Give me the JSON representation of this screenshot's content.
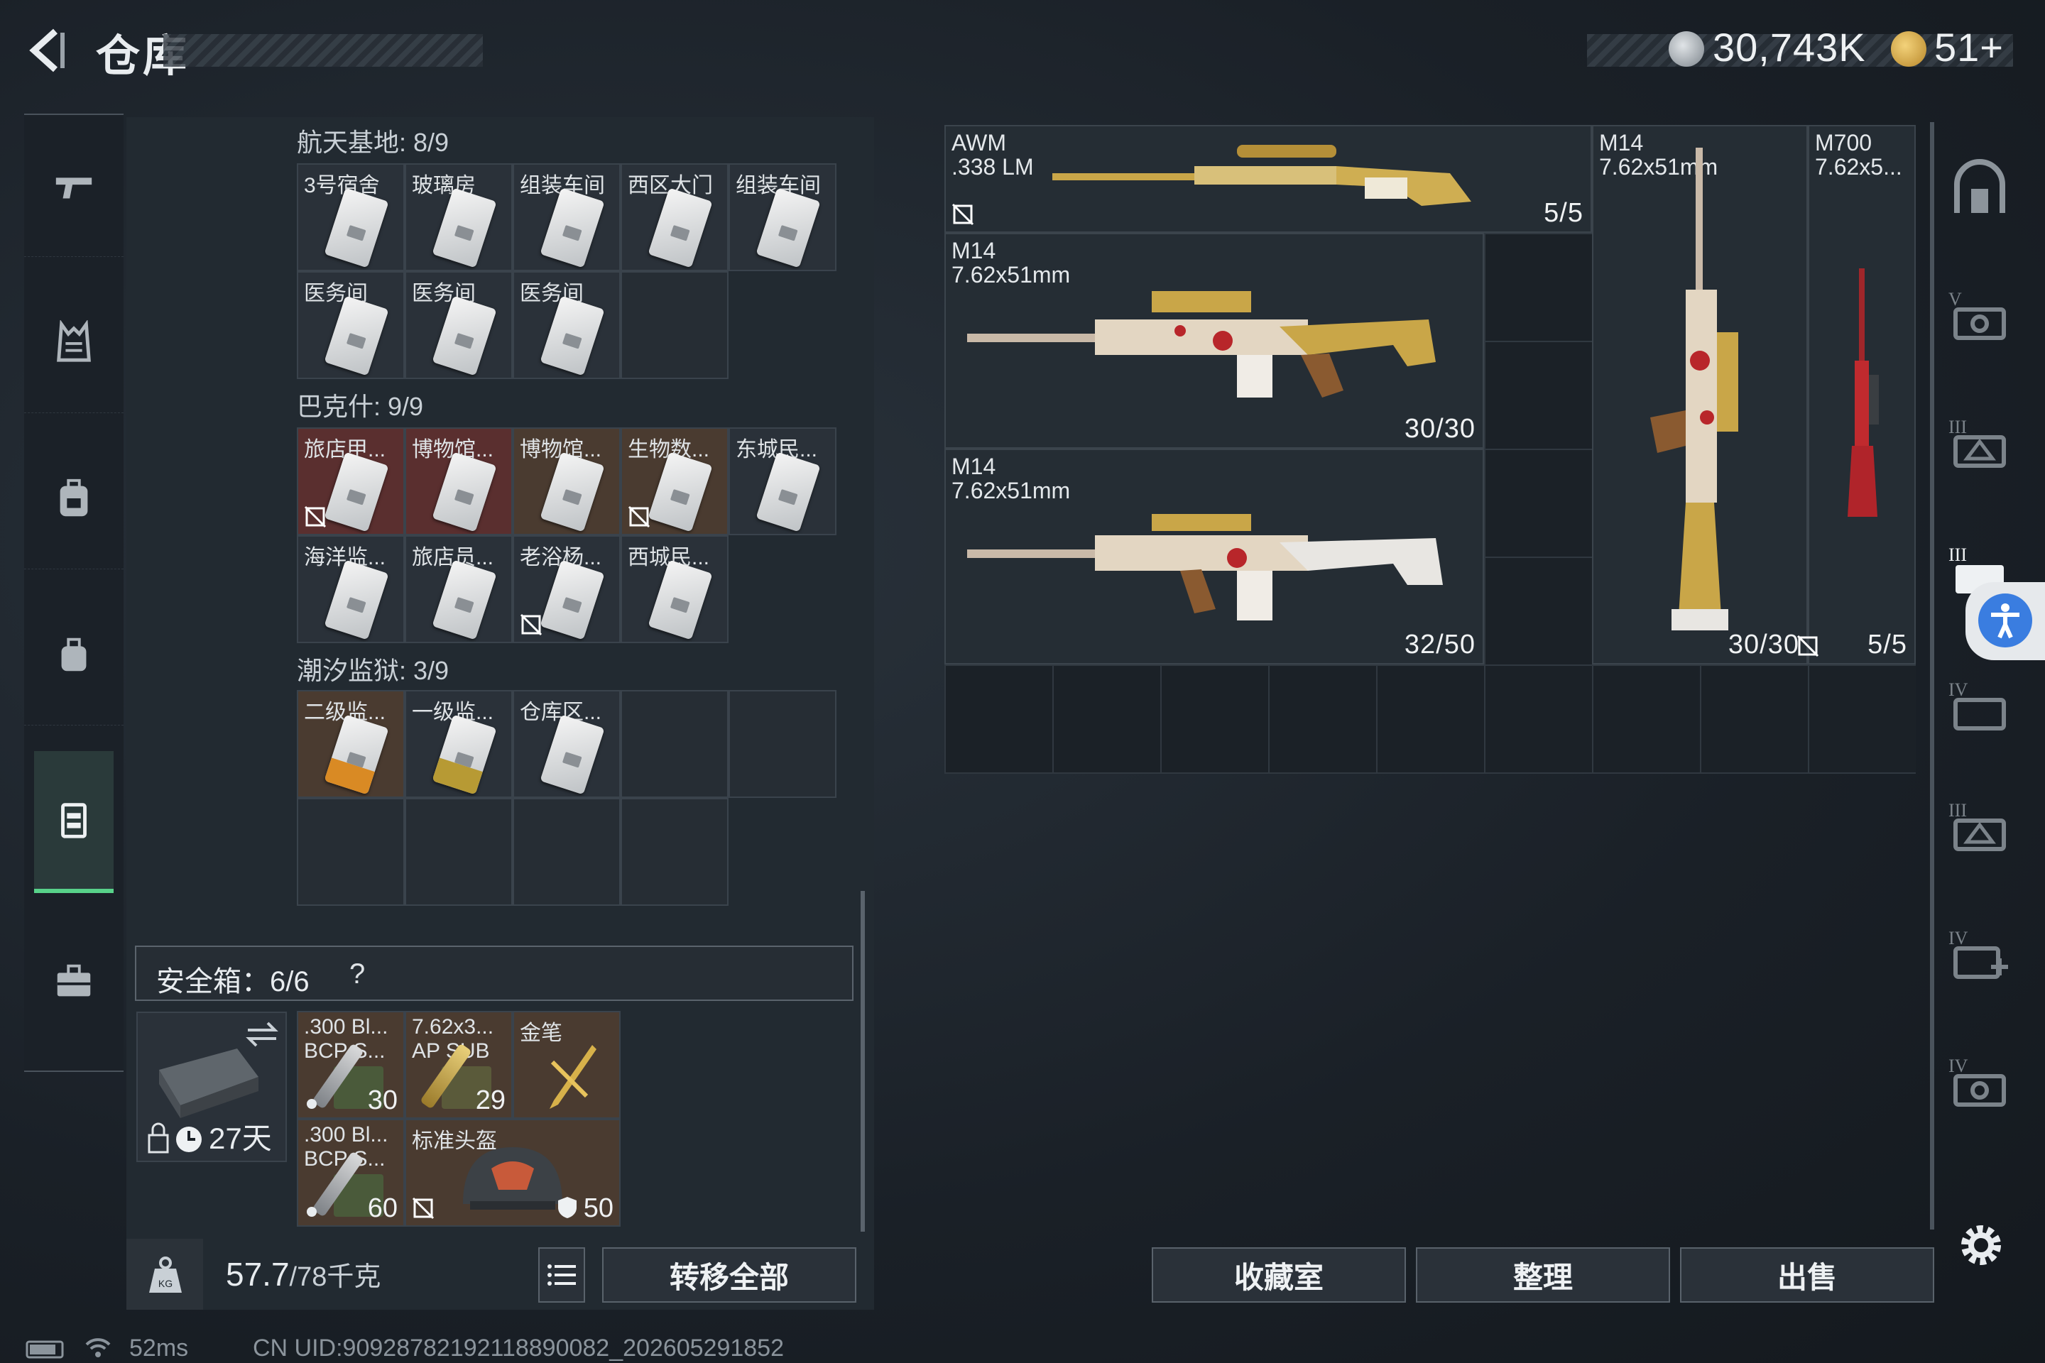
{
  "header": {
    "title": "仓库",
    "currency1": "30,743K",
    "currency2": "51+"
  },
  "left_nav": [
    "gun-icon",
    "vest-icon",
    "backpack-icon",
    "bag-icon",
    "container-icon",
    "case-icon"
  ],
  "sections": [
    {
      "title": "航天基地: 8/9",
      "items": [
        "3号宿舍",
        "玻璃房",
        "组装车间",
        "西区大门",
        "组装车间",
        "医务间",
        "医务间",
        "医务间"
      ]
    },
    {
      "title": "巴克什: 9/9",
      "items": [
        "旅店甲...",
        "博物馆...",
        "博物馆...",
        "生物数...",
        "东城民...",
        "海洋监...",
        "旅店员...",
        "老浴杨...",
        "西城民..."
      ]
    },
    {
      "title": "潮汐监狱: 3/9",
      "items": [
        "二级监...",
        "一级监...",
        "仓库区..."
      ]
    }
  ],
  "safe_box": {
    "label": "安全箱：6/6",
    "help": "?",
    "days": "27天",
    "items": [
      {
        "name": ".300 Bl... BCP S...",
        "count": "30"
      },
      {
        "name": "7.62x3... AP SUB",
        "count": "29"
      },
      {
        "name": "金笔",
        "count": ""
      },
      {
        "name": ".300 Bl... BCP S...",
        "count": "60"
      },
      {
        "name": "标准头盔",
        "count": "50"
      }
    ]
  },
  "weight": {
    "value": "57.7",
    "max": "/78千克"
  },
  "buttons": {
    "transfer_all": "转移全部",
    "collection": "收藏室",
    "organize": "整理",
    "sell": "出售"
  },
  "weapons": [
    {
      "name": "AWM",
      "caliber": ".338 LM",
      "ammo": "5/5"
    },
    {
      "name": "M14",
      "caliber": "7.62x51mm",
      "ammo": "30/30"
    },
    {
      "name": "M14",
      "caliber": "7.62x51mm",
      "ammo": "32/50"
    },
    {
      "name": "M14",
      "caliber": "7.62x51mm",
      "ammo": "30/30"
    },
    {
      "name": "M700",
      "caliber": "7.62x5...",
      "ammo": "5/5"
    }
  ],
  "status": {
    "ping": "52ms",
    "uid": "CN UID:909287821921188900​82_202605291852"
  }
}
